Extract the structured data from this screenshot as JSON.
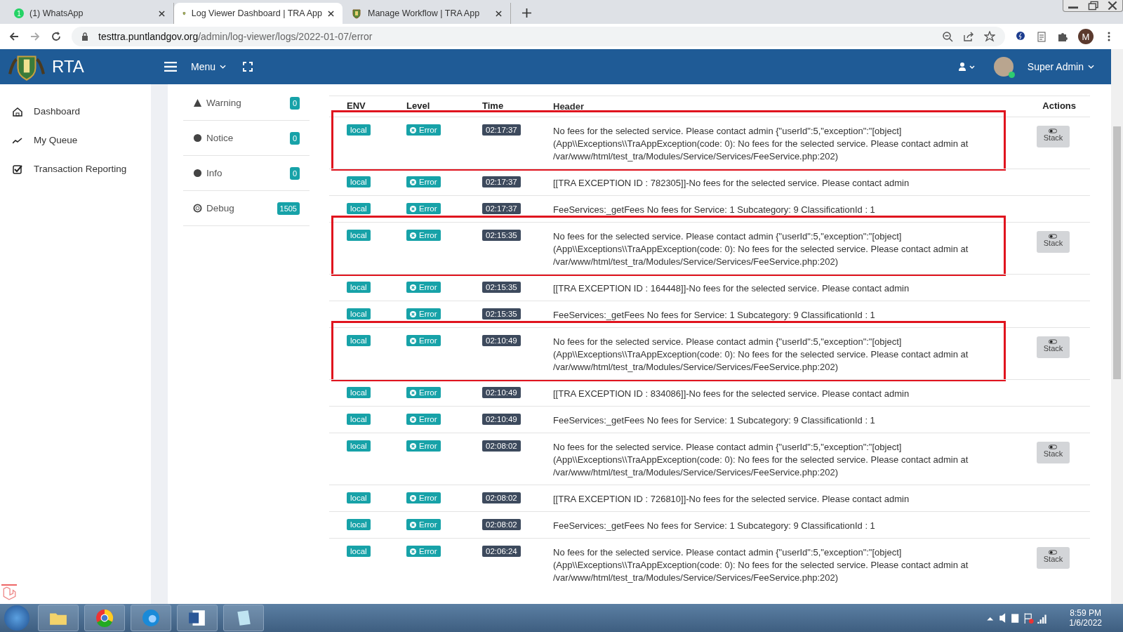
{
  "browser": {
    "tabs": [
      {
        "title": "(1) WhatsApp",
        "badge": "1",
        "selected": false,
        "kind": "chat"
      },
      {
        "title": "Log Viewer Dashboard | TRA App",
        "selected": true,
        "kind": "crest"
      },
      {
        "title": "Manage Workflow | TRA App",
        "selected": false,
        "kind": "crest"
      }
    ],
    "url_host": "testtra.puntlandgov.org",
    "url_path": "/admin/log-viewer/logs/2022-01-07/error",
    "profile": "M"
  },
  "header": {
    "brand": "RTA",
    "menu": "Menu",
    "user": "Super Admin"
  },
  "sidebar": {
    "items": [
      {
        "label": "Dashboard",
        "kind": "home"
      },
      {
        "label": "My Queue",
        "kind": "trend"
      },
      {
        "label": "Transaction Reporting",
        "kind": "check"
      }
    ]
  },
  "levels": [
    {
      "label": "Warning",
      "count": "0",
      "kind": "warning"
    },
    {
      "label": "Notice",
      "count": "0",
      "kind": "notice"
    },
    {
      "label": "Info",
      "count": "0",
      "kind": "info"
    },
    {
      "label": "Debug",
      "count": "1505",
      "kind": "debug"
    }
  ],
  "table": {
    "columns": [
      "ENV",
      "Level",
      "Time",
      "Header",
      "Actions"
    ],
    "rows": [
      {
        "env": "local",
        "level": "Error",
        "time": "02:17:37",
        "header": "No fees for the selected service. Please contact admin {\"userId\":5,\"exception\":\"[object] (App\\\\Exceptions\\\\TraAppException(code: 0): No fees for the selected service. Please contact admin at /var/www/html/test_tra/Modules/Service/Services/FeeService.php:202)",
        "action": "Stack",
        "highlighted": true
      },
      {
        "env": "local",
        "level": "Error",
        "time": "02:17:37",
        "header": "[[TRA EXCEPTION ID : 782305]]-No fees for the selected service. Please contact admin",
        "highlighted": false
      },
      {
        "env": "local",
        "level": "Error",
        "time": "02:17:37",
        "header": "FeeServices:_getFees No fees for Service: 1 Subcategory: 9 ClassificationId : 1",
        "highlighted": false
      },
      {
        "env": "local",
        "level": "Error",
        "time": "02:15:35",
        "header": "No fees for the selected service. Please contact admin {\"userId\":5,\"exception\":\"[object] (App\\\\Exceptions\\\\TraAppException(code: 0): No fees for the selected service. Please contact admin at /var/www/html/test_tra/Modules/Service/Services/FeeService.php:202)",
        "action": "Stack",
        "highlighted": true
      },
      {
        "env": "local",
        "level": "Error",
        "time": "02:15:35",
        "header": "[[TRA EXCEPTION ID : 164448]]-No fees for the selected service. Please contact admin",
        "highlighted": false
      },
      {
        "env": "local",
        "level": "Error",
        "time": "02:15:35",
        "header": "FeeServices:_getFees No fees for Service: 1 Subcategory: 9 ClassificationId : 1",
        "highlighted": false
      },
      {
        "env": "local",
        "level": "Error",
        "time": "02:10:49",
        "header": "No fees for the selected service. Please contact admin {\"userId\":5,\"exception\":\"[object] (App\\\\Exceptions\\\\TraAppException(code: 0): No fees for the selected service. Please contact admin at /var/www/html/test_tra/Modules/Service/Services/FeeService.php:202)",
        "action": "Stack",
        "highlighted": true
      },
      {
        "env": "local",
        "level": "Error",
        "time": "02:10:49",
        "header": "[[TRA EXCEPTION ID : 834086]]-No fees for the selected service. Please contact admin",
        "highlighted": false
      },
      {
        "env": "local",
        "level": "Error",
        "time": "02:10:49",
        "header": "FeeServices:_getFees No fees for Service: 1 Subcategory: 9 ClassificationId : 1",
        "highlighted": false
      },
      {
        "env": "local",
        "level": "Error",
        "time": "02:08:02",
        "header": "No fees for the selected service. Please contact admin {\"userId\":5,\"exception\":\"[object] (App\\\\Exceptions\\\\TraAppException(code: 0): No fees for the selected service. Please contact admin at /var/www/html/test_tra/Modules/Service/Services/FeeService.php:202)",
        "action": "Stack",
        "highlighted": false
      },
      {
        "env": "local",
        "level": "Error",
        "time": "02:08:02",
        "header": "[[TRA EXCEPTION ID : 726810]]-No fees for the selected service. Please contact admin",
        "highlighted": false
      },
      {
        "env": "local",
        "level": "Error",
        "time": "02:08:02",
        "header": "FeeServices:_getFees No fees for Service: 1 Subcategory: 9 ClassificationId : 1",
        "highlighted": false
      },
      {
        "env": "local",
        "level": "Error",
        "time": "02:06:24",
        "header": "No fees for the selected service. Please contact admin {\"userId\":5,\"exception\":\"[object] (App\\\\Exceptions\\\\TraAppException(code: 0): No fees for the selected service. Please contact admin at /var/www/html/test_tra/Modules/Service/Services/FeeService.php:202)",
        "action": "Stack",
        "highlighted": false
      }
    ]
  },
  "taskbar": {
    "time": "8:59 PM",
    "date": "1/6/2022"
  }
}
